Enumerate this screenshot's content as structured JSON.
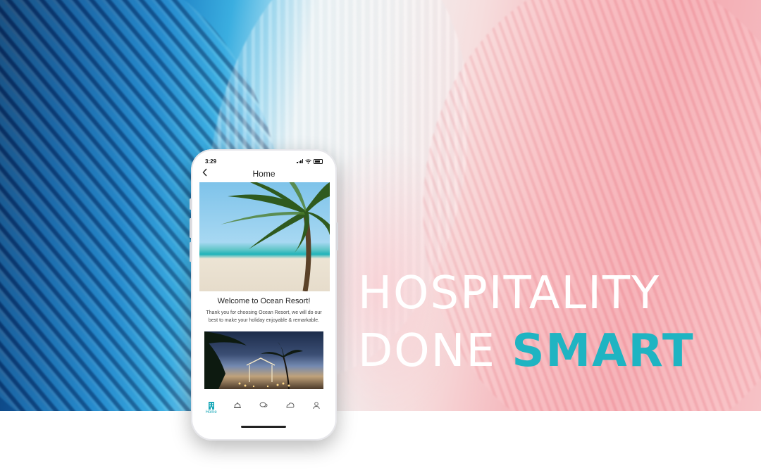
{
  "headline": {
    "line1": "HOSPITALITY",
    "line2_word1": "DONE",
    "line2_word2": "SMART",
    "accent_color": "#1fb4c2"
  },
  "phone": {
    "status": {
      "time": "3:29"
    },
    "nav": {
      "back_icon": "chevron-left-icon",
      "title": "Home"
    },
    "welcome": {
      "title": "Welcome to Ocean Resort!",
      "body": "Thank you for choosing Ocean Resort, we will do our best to make your holiday enjoyable & remarkable."
    },
    "tabs": [
      {
        "name": "home",
        "icon": "hotel-icon",
        "label": "Home",
        "active": true
      },
      {
        "name": "services",
        "icon": "bell-icon",
        "label": "",
        "active": false
      },
      {
        "name": "chat",
        "icon": "chat-icon",
        "label": "",
        "active": false
      },
      {
        "name": "explore",
        "icon": "map-icon",
        "label": "",
        "active": false
      },
      {
        "name": "profile",
        "icon": "user-icon",
        "label": "",
        "active": false
      }
    ]
  }
}
